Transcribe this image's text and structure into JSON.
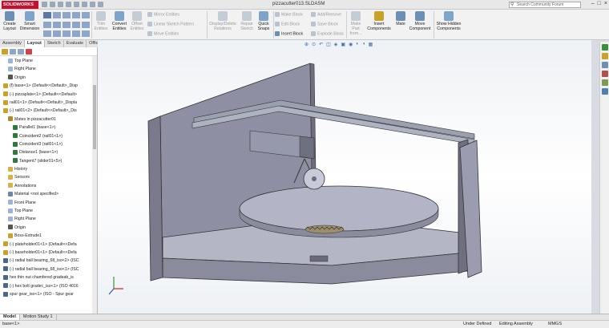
{
  "app": {
    "logo": "SOLIDWORKS",
    "window_title": "pizzacutter013.SLDASM",
    "search_placeholder": "Search Community Forum"
  },
  "ribbon": {
    "create_layout": "Create Layout",
    "smart_dimension": "Smart Dimension",
    "trim_entities": "Trim Entities",
    "convert_entities": "Convert Entities",
    "offset_entities": "Offset Entities",
    "mirror_entities": "Mirror Entities",
    "linear_sketch_pattern": "Linear Sketch Pattern",
    "move_entities": "Move Entities",
    "display_delete_relations": "Display/Delete Relations",
    "repair_sketch": "Repair Sketch",
    "quick_snaps": "Quick Snaps",
    "make_block": "Make Block",
    "edit_block": "Edit Block",
    "insert_block": "Insert Block",
    "add_remove": "Add/Remove",
    "save_block": "Save Block",
    "explode_block": "Explode Block",
    "make_part_from_block": "Make Part from...",
    "insert_components": "Insert Components",
    "mate": "Mate",
    "move_component": "Move Component",
    "show_hidden_components": "Show Hidden Components"
  },
  "tabs": [
    "Assembly",
    "Layout",
    "Sketch",
    "Evaluate",
    "Office Products"
  ],
  "active_tab": "Layout",
  "tree": [
    {
      "label": "Top Plane",
      "indent": 1,
      "icon": "plane"
    },
    {
      "label": "Right Plane",
      "indent": 1,
      "icon": "plane"
    },
    {
      "label": "Origin",
      "indent": 1,
      "icon": "origin"
    },
    {
      "label": "(f) base<1> (Default<<Default>_Disp",
      "indent": 0,
      "icon": "part"
    },
    {
      "label": "(-) pizzaplate<1> (Default<<Default>",
      "indent": 0,
      "icon": "part"
    },
    {
      "label": "rail01<1> (Default<<Default>_Displa",
      "indent": 0,
      "icon": "part"
    },
    {
      "label": "(-) rail01<2> (Default<<Default>_Dis",
      "indent": 0,
      "icon": "part"
    },
    {
      "label": "Mates in pizzacutter01",
      "indent": 1,
      "icon": "mates"
    },
    {
      "label": "Parallel1 (base<1>)",
      "indent": 2,
      "icon": "mate"
    },
    {
      "label": "Coincident2 (rail01<1>)",
      "indent": 2,
      "icon": "mate"
    },
    {
      "label": "Coincident3 (rail01<1>)",
      "indent": 2,
      "icon": "mate"
    },
    {
      "label": "Distance1 (base<1>)",
      "indent": 2,
      "icon": "mate"
    },
    {
      "label": "Tangent7 (slider01<5>)",
      "indent": 2,
      "icon": "mate"
    },
    {
      "label": "History",
      "indent": 1,
      "icon": "folder"
    },
    {
      "label": "Sensors",
      "indent": 1,
      "icon": "folder"
    },
    {
      "label": "Annotations",
      "indent": 1,
      "icon": "folder"
    },
    {
      "label": "Material <not specified>",
      "indent": 1,
      "icon": "material"
    },
    {
      "label": "Front Plane",
      "indent": 1,
      "icon": "plane"
    },
    {
      "label": "Top Plane",
      "indent": 1,
      "icon": "plane"
    },
    {
      "label": "Right Plane",
      "indent": 1,
      "icon": "plane"
    },
    {
      "label": "Origin",
      "indent": 1,
      "icon": "origin"
    },
    {
      "label": "Boss-Extrude1",
      "indent": 1,
      "icon": "feature"
    },
    {
      "label": "(-) plateholder01<1> (Default<<Defa",
      "indent": 0,
      "icon": "part"
    },
    {
      "label": "(-) baseholder01<1> (Default<<Defa",
      "indent": 0,
      "icon": "part"
    },
    {
      "label": "(-) radial ball bearing_68_iso<2> (ISC",
      "indent": 0,
      "icon": "toolbox"
    },
    {
      "label": "(-) radial ball bearing_68_iso<1> (ISC",
      "indent": 0,
      "icon": "toolbox"
    },
    {
      "label": "hex thin nut chamfered gradeab_is",
      "indent": 0,
      "icon": "toolbox"
    },
    {
      "label": "(-) hex bolt gradec_iso<1> (ISO 4016",
      "indent": 0,
      "icon": "toolbox"
    },
    {
      "label": "spur gear_iso<1> (ISO - Spur gear",
      "indent": 0,
      "icon": "toolbox"
    }
  ],
  "bottom_tabs": [
    "Model",
    "Motion Study 1"
  ],
  "status": {
    "left": "base<1>",
    "under_defined": "Under Defined",
    "editing": "Editing Assembly",
    "units": "MMGS"
  },
  "colors": {
    "model_gray": "#a9abbd",
    "accent_blue": "#3a6ea8",
    "logo_red": "#c8102e"
  }
}
